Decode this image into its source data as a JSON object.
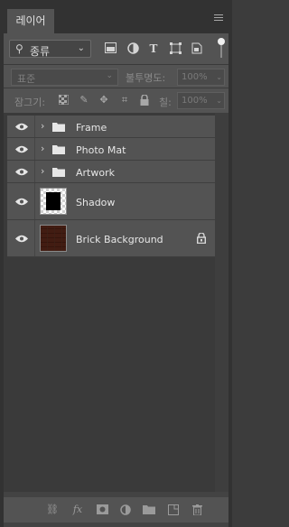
{
  "tab": {
    "title": "레이어"
  },
  "filter": {
    "kind_label": "종류",
    "chevron": "⌄"
  },
  "blend": {
    "mode": "표준",
    "opacity_label": "불투명도:",
    "opacity_value": "100%"
  },
  "lock": {
    "label": "잠그기:",
    "fill_label": "칠:",
    "fill_value": "100%"
  },
  "layers": [
    {
      "name": "Frame",
      "type": "group",
      "visible": true
    },
    {
      "name": "Photo Mat",
      "type": "group",
      "visible": true
    },
    {
      "name": "Artwork",
      "type": "group",
      "visible": true
    },
    {
      "name": "Shadow",
      "type": "layer",
      "visible": true,
      "thumbnail": "shadow-thumbnail"
    },
    {
      "name": "Brick Background",
      "type": "layer",
      "visible": true,
      "locked": true,
      "thumbnail": "brick-thumbnail"
    }
  ],
  "colors": {
    "panel": "#535353",
    "background": "#434343",
    "dark": "#323232",
    "text": "#e6e6e6"
  }
}
